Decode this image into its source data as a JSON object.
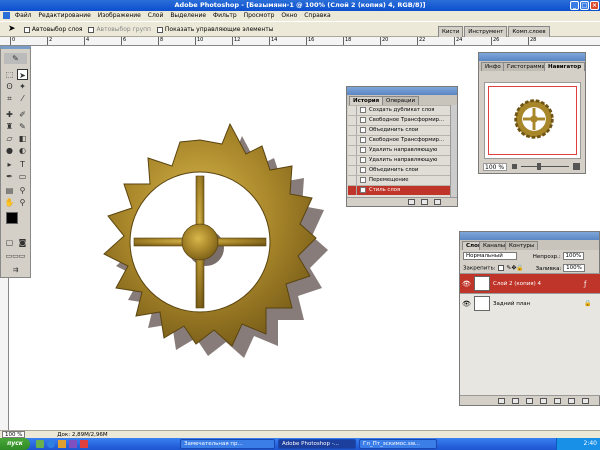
{
  "window": {
    "title": "Adobe Photoshop - [Безымянн-1 @ 100% (Слой 2 (копия) 4, RGB/8)]",
    "controls": [
      "_",
      "□",
      "×"
    ]
  },
  "menu": [
    "Файл",
    "Редактирование",
    "Изображение",
    "Слой",
    "Выделение",
    "Фильтр",
    "Просмотр",
    "Окно",
    "Справка"
  ],
  "options_bar": {
    "autoselect_layer": "Автовыбор слоя",
    "autoselect_group": "Автовыбор групп",
    "show_controls": "Показать управляющие элементы",
    "palette_tabs": [
      "Кисти",
      "Инструмент",
      "Комп.слоев"
    ]
  },
  "ruler_top": [
    "0",
    "2",
    "4",
    "6",
    "8",
    "10",
    "12",
    "14",
    "16",
    "18",
    "20",
    "22",
    "24",
    "26",
    "28"
  ],
  "history": {
    "tabs": [
      "История",
      "Операции"
    ],
    "rows": [
      "Создать дубликат слоя",
      "Свободное Трансформир...",
      "Объединить слои",
      "Свободное Трансформир...",
      "Удалить направляющую",
      "Удалить направляющую",
      "Объединить слои",
      "Перемещение",
      "Стиль слоя"
    ],
    "selected_index": 8
  },
  "navigator": {
    "tabs": [
      "Инфо",
      "Гистограмма",
      "Навигатор"
    ],
    "zoom": "100 %"
  },
  "layers": {
    "tabs": [
      "Слои",
      "Каналы",
      "Контуры"
    ],
    "blend_mode": "Нормальный",
    "opacity_label": "Непрозр.:",
    "opacity": "100%",
    "lock_label": "Закрепить:",
    "fill_label": "Заливка:",
    "fill": "100%",
    "items": [
      {
        "name": "Слой 2 (копия) 4",
        "selected": true
      },
      {
        "name": "Задний план",
        "selected": false
      }
    ]
  },
  "status": {
    "zoom": "100 %",
    "doc": "Док: 2,89M/2,96M"
  },
  "taskbar": {
    "start": "пуск",
    "tasks": [
      "Замечательная пр...",
      "Adobe Photoshop -...",
      "Гл_Пт_эскимос.sw..."
    ],
    "clock": "2:40"
  },
  "colors": {
    "title_blue": "#0b4fcf",
    "selection_red": "#c0352a",
    "panel_gray": "#d4d0c8",
    "gear_gold": "#a8862a"
  }
}
